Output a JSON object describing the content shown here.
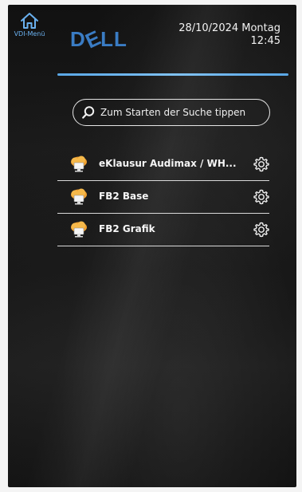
{
  "header": {
    "vdi_menu_label": "VDI-Menü",
    "date": "28/10/2024 Montag",
    "time": "12:45"
  },
  "logo": {
    "left": "D",
    "e": "E",
    "right": "LL"
  },
  "search": {
    "placeholder": "Zum Starten der Suche tippen",
    "value": ""
  },
  "desktops": [
    {
      "label": "eKlausur Audimax / WH...",
      "icon": "cloud-desktop-icon",
      "settings_icon": "gear-icon"
    },
    {
      "label": "FB2 Base",
      "icon": "cloud-desktop-icon",
      "settings_icon": "gear-icon"
    },
    {
      "label": "FB2 Grafik",
      "icon": "cloud-desktop-icon",
      "settings_icon": "gear-icon"
    }
  ],
  "colors": {
    "accent_blue": "#5aa7e6",
    "vdi_label": "#6ab1f0",
    "dell_blue": "#3a7cc4",
    "cloud_orange": "#f0a030"
  }
}
